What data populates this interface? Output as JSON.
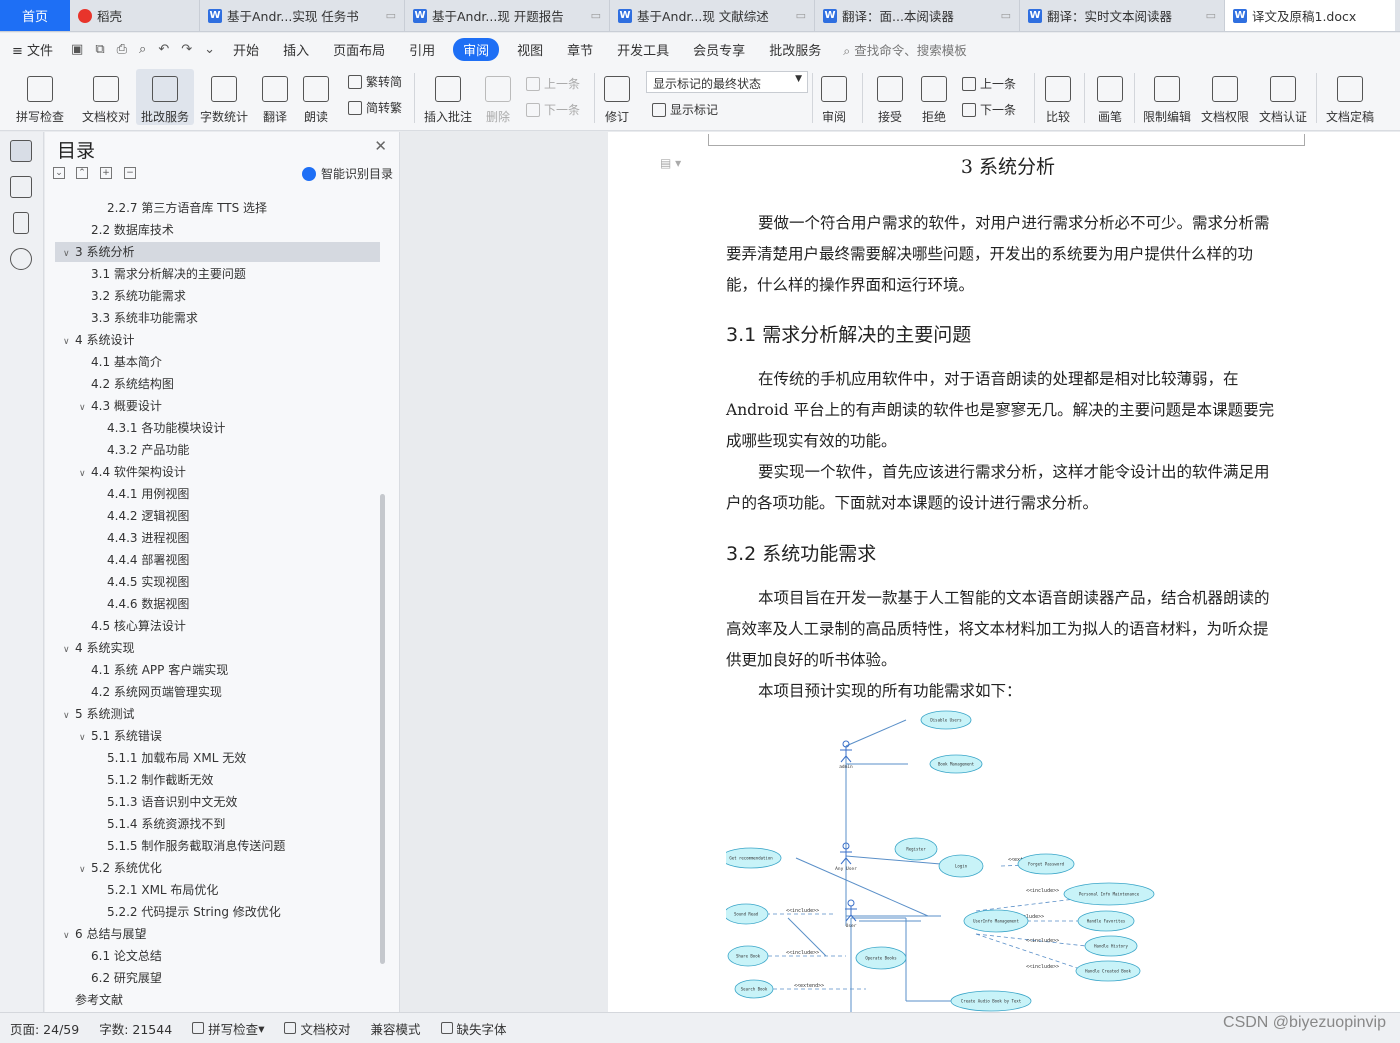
{
  "tabs": {
    "home": "首页",
    "items": [
      {
        "label": "稻壳",
        "kind": "d"
      },
      {
        "label": "基于Andr...实现 任务书",
        "kind": "w"
      },
      {
        "label": "基于Andr...现 开题报告",
        "kind": "w"
      },
      {
        "label": "基于Andr...现 文献综述",
        "kind": "w"
      },
      {
        "label": "翻译：面...本阅读器",
        "kind": "w"
      },
      {
        "label": "翻译：实时文本阅读器",
        "kind": "w"
      },
      {
        "label": "译文及原稿1.docx",
        "kind": "w"
      }
    ]
  },
  "menu": {
    "file": "文件",
    "items": [
      "开始",
      "插入",
      "页面布局",
      "引用",
      "审阅",
      "视图",
      "章节",
      "开发工具",
      "会员专享",
      "批改服务"
    ],
    "active": "审阅",
    "search": "查找命令、搜索模板"
  },
  "ribbon": {
    "spell_check": "拼写检查",
    "doc_proof": "文档校对",
    "correction_service": "批改服务",
    "word_count": "字数统计",
    "translate": "翻译",
    "read_aloud": "朗读",
    "trad_to_simp": "繁转简",
    "simp_to_trad": "简转繁",
    "insert_comment": "插入批注",
    "delete": "删除",
    "prev": "上一条",
    "next": "下一条",
    "track_changes": "修订",
    "markup_state": "显示标记的最终状态",
    "show_markup": "显示标记",
    "review": "审阅",
    "accept": "接受",
    "reject": "拒绝",
    "prev2": "上一条",
    "next2": "下一条",
    "compare": "比较",
    "ink": "画笔",
    "restrict_edit": "限制编辑",
    "doc_permission": "文档权限",
    "doc_cert": "文档认证",
    "doc_finalize": "文档定稿"
  },
  "toc": {
    "title": "目录",
    "smart": "智能识别目录",
    "items": [
      {
        "text": "2.2.7 第三方语音库 TTS 选择",
        "level": 3,
        "caret": ""
      },
      {
        "text": "2.2  数据库技术",
        "level": 2,
        "caret": ""
      },
      {
        "text": "3 系统分析",
        "level": 1,
        "caret": "v",
        "selected": true
      },
      {
        "text": "3.1 需求分析解决的主要问题",
        "level": 2,
        "caret": ""
      },
      {
        "text": "3.2 系统功能需求",
        "level": 2,
        "caret": ""
      },
      {
        "text": "3.3 系统非功能需求",
        "level": 2,
        "caret": ""
      },
      {
        "text": "4  系统设计",
        "level": 1,
        "caret": "v"
      },
      {
        "text": "4.1 基本简介",
        "level": 2,
        "caret": ""
      },
      {
        "text": "4.2 系统结构图",
        "level": 2,
        "caret": ""
      },
      {
        "text": "4.3 概要设计",
        "level": 2,
        "caret": "v"
      },
      {
        "text": "4.3.1 各功能模块设计",
        "level": 3,
        "caret": ""
      },
      {
        "text": "4.3.2 产品功能",
        "level": 3,
        "caret": ""
      },
      {
        "text": "4.4 软件架构设计",
        "level": 2,
        "caret": "v"
      },
      {
        "text": "4.4.1 用例视图",
        "level": 3,
        "caret": ""
      },
      {
        "text": "4.4.2 逻辑视图",
        "level": 3,
        "caret": ""
      },
      {
        "text": "4.4.3 进程视图",
        "level": 3,
        "caret": ""
      },
      {
        "text": "4.4.4 部署视图",
        "level": 3,
        "caret": ""
      },
      {
        "text": "4.4.5 实现视图",
        "level": 3,
        "caret": ""
      },
      {
        "text": "4.4.6 数据视图",
        "level": 3,
        "caret": ""
      },
      {
        "text": "4.5 核心算法设计",
        "level": 2,
        "caret": ""
      },
      {
        "text": "4 系统实现",
        "level": 1,
        "caret": "v"
      },
      {
        "text": "4.1 系统 APP 客户端实现",
        "level": 2,
        "caret": ""
      },
      {
        "text": "4.2 系统网页端管理实现",
        "level": 2,
        "caret": ""
      },
      {
        "text": "5 系统测试",
        "level": 1,
        "caret": "v"
      },
      {
        "text": "5.1 系统错误",
        "level": 2,
        "caret": "v"
      },
      {
        "text": "5.1.1 加载布局 XML 无效",
        "level": 3,
        "caret": ""
      },
      {
        "text": "5.1.2 制作截断无效",
        "level": 3,
        "caret": ""
      },
      {
        "text": "5.1.3 语音识别中文无效",
        "level": 3,
        "caret": ""
      },
      {
        "text": "5.1.4 系统资源找不到",
        "level": 3,
        "caret": ""
      },
      {
        "text": "5.1.5 制作服务截取消息传送问题",
        "level": 3,
        "caret": ""
      },
      {
        "text": "5.2 系统优化",
        "level": 2,
        "caret": "v"
      },
      {
        "text": "5.2.1 XML 布局优化",
        "level": 3,
        "caret": ""
      },
      {
        "text": "5.2.2 代码提示 String 修改优化",
        "level": 3,
        "caret": ""
      },
      {
        "text": "6 总结与展望",
        "level": 1,
        "caret": "v"
      },
      {
        "text": "6.1 论文总结",
        "level": 2,
        "caret": ""
      },
      {
        "text": "6.2 研究展望",
        "level": 2,
        "caret": ""
      },
      {
        "text": "参考文献",
        "level": 1,
        "caret": ""
      }
    ]
  },
  "doc": {
    "heading": "3 系统分析",
    "p1": "要做一个符合用户需求的软件，对用户进行需求分析必不可少。需求分析需要弄清楚用户最终需要解决哪些问题，开发出的系统要为用户提供什么样的功能，什么样的操作界面和运行环境。",
    "h31": "3.1 需求分析解决的主要问题",
    "p2": "在传统的手机应用软件中，对于语音朗读的处理都是相对比较薄弱，在 Android 平台上的有声朗读的软件也是寥寥无几。解决的主要问题是本课题要完成哪些现实有效的功能。",
    "p3": "要实现一个软件，首先应该进行需求分析，这样才能令设计出的软件满足用户的各项功能。下面就对本课题的设计进行需求分析。",
    "h32": "3.2 系统功能需求",
    "p4": "本项目旨在开发一款基于人工智能的文本语音朗读器产品，结合机器朗读的高效率及人工录制的高品质特性，将文本材料加工为拟人的语音材料，为听众提供更加良好的听书体验。",
    "p5": "本项目预计实现的所有功能需求如下："
  },
  "diagram": {
    "actors": [
      "admin",
      "Any User",
      "User"
    ],
    "usecases": [
      "Disable Users",
      "Book Management",
      "Register",
      "Login",
      "Forget Password",
      "Get recommendation",
      "Personal Info Maintenance",
      "Sound Read",
      "UserInfo Management",
      "Handle Favorites",
      "Handle History",
      "Share Book",
      "Operate Books",
      "Handle Created Book",
      "Search Book",
      "Create Audio Book by Text"
    ],
    "stereotypes": [
      "<<include>>",
      "<<extend>>"
    ]
  },
  "status": {
    "page": "页面: 24/59",
    "words": "字数: 21544",
    "spell": "拼写检查",
    "proof": "文档校对",
    "compat": "兼容模式",
    "missing_font": "缺失字体"
  },
  "watermark": "CSDN @biyezuopinvip",
  "colors": {
    "accent": "#1e6ff5",
    "usecase_fill": "#c8f3f8",
    "usecase_stroke": "#3aa5c8"
  }
}
